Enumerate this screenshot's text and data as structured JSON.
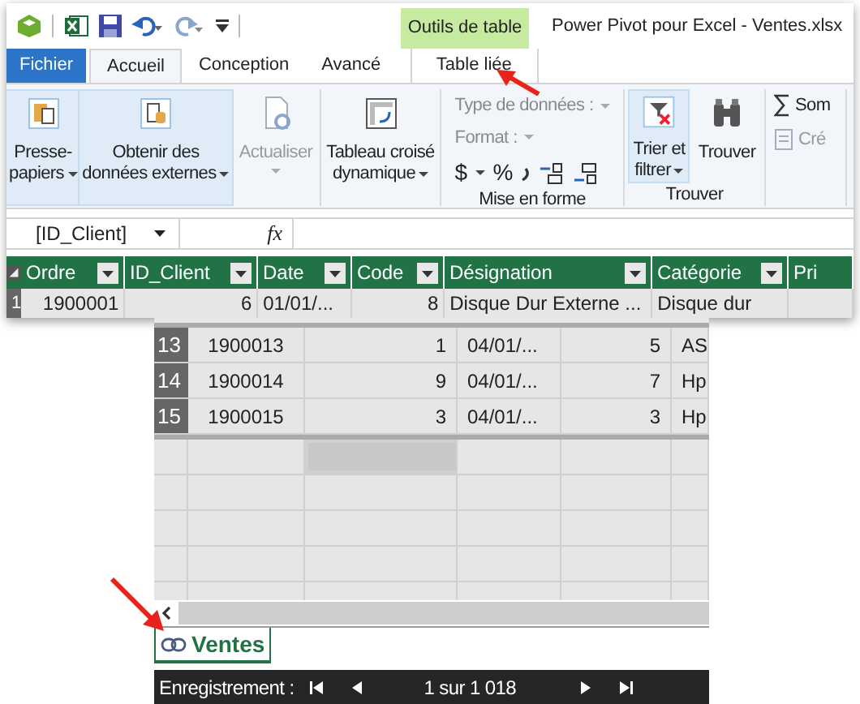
{
  "window": {
    "title": "Power Pivot pour Excel - Ventes.xlsx",
    "context_group": "Outils de table"
  },
  "tabs": [
    {
      "label": "Fichier",
      "kind": "file",
      "selected": false
    },
    {
      "label": "Accueil",
      "kind": "tab",
      "selected": true
    },
    {
      "label": "Conception",
      "kind": "tab",
      "selected": false
    },
    {
      "label": "Avancé",
      "kind": "tab",
      "selected": false
    },
    {
      "label": "Table liée",
      "kind": "context",
      "selected": false
    }
  ],
  "ribbon": {
    "groups": [
      {
        "kind": "buttons",
        "buttons": [
          {
            "lines": [
              "Presse-",
              "papiers"
            ],
            "dropdown": true,
            "highlighted": true,
            "disabled": false
          }
        ]
      },
      {
        "kind": "buttons",
        "buttons": [
          {
            "lines": [
              "Obtenir des",
              "données externes"
            ],
            "dropdown": true,
            "highlighted": true,
            "disabled": false
          }
        ]
      },
      {
        "kind": "buttons",
        "buttons": [
          {
            "lines": [
              "Actualiser"
            ],
            "dropdown": true,
            "highlighted": false,
            "disabled": true
          }
        ]
      },
      {
        "kind": "buttons",
        "buttons": [
          {
            "lines": [
              "Tableau croisé",
              "dynamique"
            ],
            "dropdown": true,
            "highlighted": false,
            "disabled": false
          }
        ]
      },
      {
        "kind": "format",
        "label": "Mise en forme",
        "fields": [
          {
            "label": "Type de données :",
            "disabled": true
          },
          {
            "label": "Format :",
            "disabled": true
          }
        ],
        "symbols": [
          "$",
          "%"
        ]
      },
      {
        "kind": "buttons",
        "label": "Trouver",
        "buttons": [
          {
            "lines": [
              "Trier et",
              "filtrer"
            ],
            "dropdown": true,
            "highlighted": true,
            "disabled": false
          },
          {
            "lines": [
              "Trouver"
            ],
            "dropdown": false,
            "highlighted": false,
            "disabled": false
          }
        ]
      },
      {
        "kind": "small",
        "items": [
          {
            "label": "Som",
            "disabled": false
          },
          {
            "label": "Cré",
            "disabled": true
          }
        ]
      }
    ]
  },
  "name_box": {
    "value": "[ID_Client]"
  },
  "formula_icon": "fx",
  "table": {
    "columns": [
      {
        "label": "Ordre",
        "numeric": true
      },
      {
        "label": "ID_Client",
        "numeric": true
      },
      {
        "label": "Date",
        "numeric": false
      },
      {
        "label": "Code",
        "numeric": true
      },
      {
        "label": "Désignation",
        "numeric": false
      },
      {
        "label": "Catégorie",
        "numeric": false
      },
      {
        "label": "Pri"
      }
    ],
    "rows": [
      {
        "number": "1",
        "cells": [
          "1900001",
          "6",
          "01/01/...",
          "8",
          "Disque Dur Externe ...",
          "Disque dur",
          ""
        ]
      }
    ]
  },
  "lower_table": {
    "rows": [
      {
        "number": "13",
        "cells": [
          "1900013",
          "1",
          "04/01/...",
          "5",
          "AS"
        ]
      },
      {
        "number": "14",
        "cells": [
          "1900014",
          "9",
          "04/01/...",
          "7",
          "Hp"
        ]
      },
      {
        "number": "15",
        "cells": [
          "1900015",
          "3",
          "04/01/...",
          "3",
          "Hp"
        ]
      }
    ]
  },
  "sheet_tab": {
    "label": "Ventes",
    "selected": true
  },
  "status_bar": {
    "label": "Enregistrement :",
    "position": "1 sur 1 018"
  }
}
